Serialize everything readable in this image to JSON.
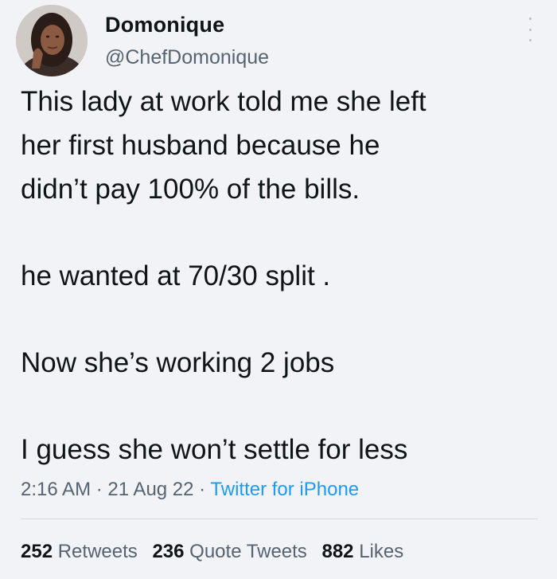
{
  "author": {
    "display_name": "Domonique",
    "handle": "@ChefDomonique"
  },
  "tweet": {
    "lines": [
      "This lady at work told me she left",
      "her first husband because he",
      "didn’t pay 100% of the bills.",
      "he wanted at 70/30 split .",
      "Now she’s working 2 jobs",
      "I guess she won’t settle for less"
    ]
  },
  "meta": {
    "time": "2:16 AM",
    "separator1": " · ",
    "date": "21 Aug 22",
    "separator2": " · ",
    "source": "Twitter for iPhone"
  },
  "stats": {
    "retweets_count": "252",
    "retweets_label": "Retweets",
    "quotes_count": "236",
    "quotes_label": "Quote Tweets",
    "likes_count": "882",
    "likes_label": "Likes"
  },
  "icons": {
    "more": "more-vertical-icon"
  },
  "colors": {
    "text": "#0f1419",
    "secondary": "#566370",
    "link": "#1d9bf0",
    "background": "#f2f3f6"
  }
}
